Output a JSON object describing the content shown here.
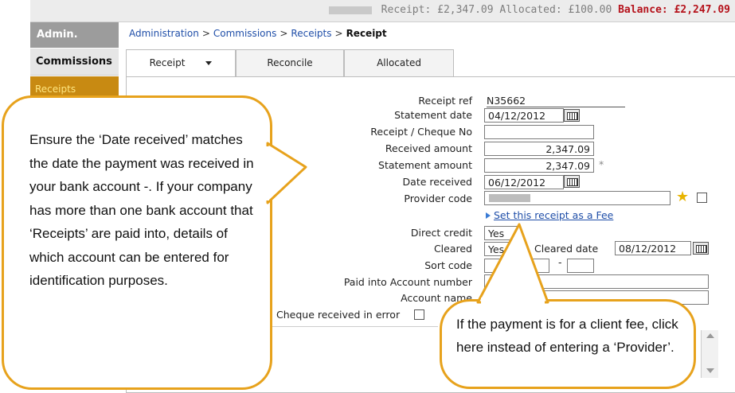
{
  "topbar": {
    "receipt_text": "Receipt: £2,347.09",
    "allocated_text": "Allocated: £100.00",
    "balance_text": "Balance: £2,247.09"
  },
  "sidebar": {
    "admin": "Admin.",
    "commissions": "Commissions",
    "receipts": "Receipts"
  },
  "breadcrumb": {
    "items": [
      "Administration",
      "Commissions",
      "Receipts"
    ],
    "separator": ">",
    "current": "Receipt"
  },
  "tabs": [
    {
      "label": "Receipt",
      "active": true
    },
    {
      "label": "Reconcile",
      "active": false
    },
    {
      "label": "Allocated",
      "active": false
    }
  ],
  "form": {
    "receipt_ref": {
      "label": "Receipt ref",
      "value": "N35662"
    },
    "statement_date": {
      "label": "Statement date",
      "value": "04/12/2012"
    },
    "cheque_no": {
      "label": "Receipt / Cheque No",
      "value": ""
    },
    "received_amount": {
      "label": "Received amount",
      "value": "2,347.09"
    },
    "statement_amount": {
      "label": "Statement amount",
      "value": "2,347.09",
      "marker": "*"
    },
    "date_received": {
      "label": "Date received",
      "value": "06/12/2012"
    },
    "provider_code": {
      "label": "Provider code",
      "value": ""
    },
    "set_fee_link": "Set this receipt as a Fee",
    "direct_credit": {
      "label": "Direct credit",
      "value": "Yes"
    },
    "cleared": {
      "label": "Cleared",
      "value": "Yes"
    },
    "cleared_date": {
      "label": "Cleared date",
      "value": "08/12/2012"
    },
    "sort_code": {
      "label": "Sort code",
      "separator": "-"
    },
    "paid_into_account": {
      "label": "Paid into Account number"
    },
    "account_name": {
      "label": "Account name"
    },
    "cheque_error": {
      "label": "Cheque received in error",
      "checked": false
    }
  },
  "callouts": {
    "left": "Ensure the ‘Date received’ matches the date the payment was received in your bank account -. If your company has more than one bank account that ‘Receipts’ are paid into, details of which account can be entered for identification purposes.",
    "right": "If the payment is for a client fee, click here instead of entering a ‘Provider’."
  },
  "colors": {
    "callout_border": "#e7a21c",
    "balance": "#b5121b",
    "link": "#1f4ea8"
  }
}
